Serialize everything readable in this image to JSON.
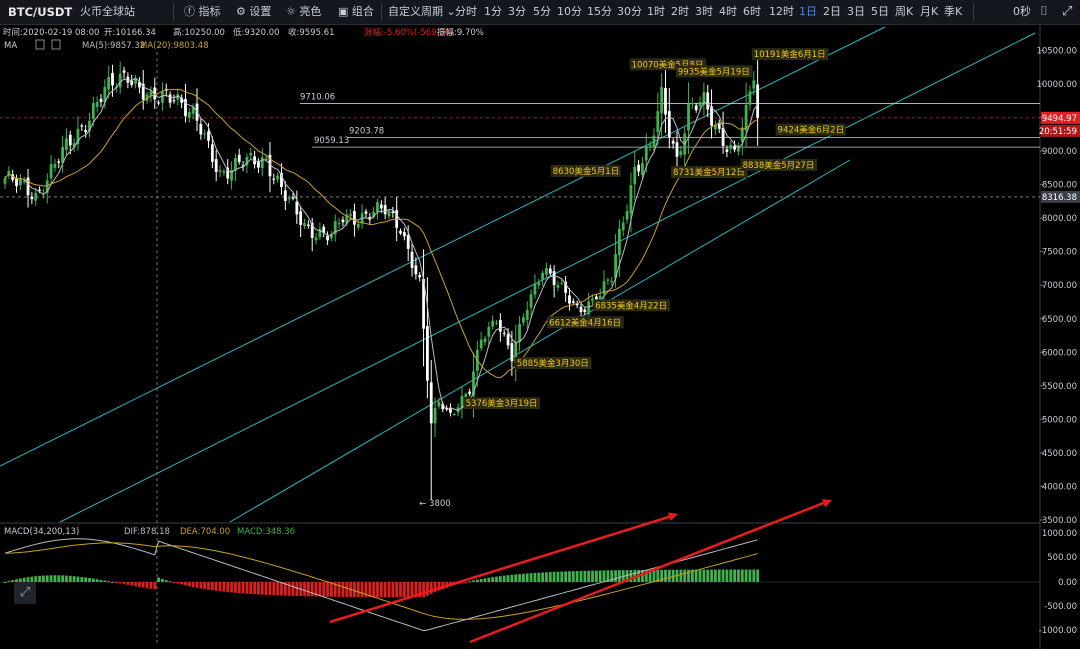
{
  "toolbar": {
    "symbol": "BTC/USDT",
    "exchange": "火币全球站",
    "indicator": "指标",
    "settings": "设置",
    "theme": "亮色",
    "combo": "组合",
    "custom": "自定义周期",
    "periods": [
      "分时",
      "1分",
      "3分",
      "5分",
      "10分",
      "15分",
      "30分",
      "1时",
      "2时",
      "3时",
      "4时",
      "6时",
      "12时",
      "1日",
      "2日",
      "3日",
      "5日",
      "周K",
      "月K",
      "季K"
    ],
    "active_period": "1日",
    "countdown": "0秒"
  },
  "info": {
    "time": "时间:2020-02-19 08:00",
    "open": "开:10166.34",
    "high": "高:10250.00",
    "low": "低:9320.00",
    "close": "收:9595.61",
    "change": "涨幅:-5.60%(-569.30)",
    "amp": "振幅:9.70%",
    "ma_label": "MA",
    "ma5": "MA(5):9857.32",
    "ma20": "MA(20):9803.48"
  },
  "macd_info": {
    "label": "MACD(34,200,13)",
    "dif": "DIF:878.18",
    "dea": "DEA:704.00",
    "macd": "MACD:348.36"
  },
  "colors": {
    "up": "#3fb34f",
    "down": "#ffffff",
    "ma5": "#b8bcc4",
    "ma20": "#c9a227",
    "channel": "#27b7bf",
    "arrow": "#e81c1c",
    "label_bg": "#2b2b14",
    "label_fg": "#f0c419",
    "price_tag": "#e02020"
  },
  "price_axis": {
    "ticks": [
      10500,
      10000,
      9500,
      9000,
      8500,
      8000,
      7500,
      7000,
      6500,
      6000,
      5500,
      5000,
      4500,
      4000,
      3500
    ],
    "current": "9494.97",
    "timer": "20:51:59",
    "hline": "8316.38"
  },
  "macd_axis": {
    "ticks": [
      "1000.00",
      "500.00",
      "0.00",
      "-500.00",
      "-1000.00"
    ]
  },
  "hlines": [
    {
      "price": 9710.06,
      "label": "9710.06"
    },
    {
      "price": 9203.78,
      "label": "9203.78"
    },
    {
      "price": 9059.13,
      "label": "9059.13"
    }
  ],
  "annotations": [
    {
      "text": "10191美金6月1日",
      "price": 10191,
      "idx": 195
    },
    {
      "text": "10070美金5月8日",
      "price": 10070,
      "idx": 171
    },
    {
      "text": "9935美金5月19日",
      "price": 9935,
      "idx": 182
    },
    {
      "text": "9424美金6月2日",
      "price": 9424,
      "idx": 196
    },
    {
      "text": "8630美金5月1日",
      "price": 8630,
      "idx": 164
    },
    {
      "text": "8731美金5月12日",
      "price": 8731,
      "idx": 175
    },
    {
      "text": "8838美金5月27日",
      "price": 8838,
      "idx": 190
    },
    {
      "text": "6835美金4月22日",
      "price": 6835,
      "idx": 155
    },
    {
      "text": "6612美金4月16日",
      "price": 6612,
      "idx": 149
    },
    {
      "text": "5885美金3月30日",
      "price": 5885,
      "idx": 132
    },
    {
      "text": "5376美金3月19日",
      "price": 5376,
      "idx": 121
    },
    {
      "text": "3800",
      "price": 3800,
      "idx": 111
    }
  ],
  "chart_data": {
    "type": "candlestick",
    "title": "BTC/USDT",
    "ylim": [
      3350,
      10750
    ],
    "anchors": [
      {
        "i": 0,
        "p": 8600
      },
      {
        "i": 8,
        "p": 8350
      },
      {
        "i": 15,
        "p": 8950
      },
      {
        "i": 25,
        "p": 9800
      },
      {
        "i": 32,
        "p": 10200
      },
      {
        "i": 38,
        "p": 9700
      },
      {
        "i": 44,
        "p": 9900
      },
      {
        "i": 50,
        "p": 9400
      },
      {
        "i": 56,
        "p": 8700
      },
      {
        "i": 62,
        "p": 8800
      },
      {
        "i": 68,
        "p": 8900
      },
      {
        "i": 73,
        "p": 8300
      },
      {
        "i": 78,
        "p": 7900
      },
      {
        "i": 85,
        "p": 7700
      },
      {
        "i": 88,
        "p": 8000
      },
      {
        "i": 99,
        "p": 8100
      },
      {
        "i": 103,
        "p": 7900
      },
      {
        "i": 108,
        "p": 7000
      },
      {
        "i": 111,
        "p": 4900
      },
      {
        "i": 113,
        "p": 5300
      },
      {
        "i": 116,
        "p": 5100
      },
      {
        "i": 121,
        "p": 5400
      },
      {
        "i": 124,
        "p": 6200
      },
      {
        "i": 128,
        "p": 6550
      },
      {
        "i": 132,
        "p": 5900
      },
      {
        "i": 136,
        "p": 6700
      },
      {
        "i": 140,
        "p": 7300
      },
      {
        "i": 145,
        "p": 6900
      },
      {
        "i": 149,
        "p": 6650
      },
      {
        "i": 155,
        "p": 6850
      },
      {
        "i": 158,
        "p": 7100
      },
      {
        "i": 160,
        "p": 7750
      },
      {
        "i": 164,
        "p": 8750
      },
      {
        "i": 168,
        "p": 9000
      },
      {
        "i": 171,
        "p": 9800
      },
      {
        "i": 175,
        "p": 8900
      },
      {
        "i": 178,
        "p": 9600
      },
      {
        "i": 182,
        "p": 9700
      },
      {
        "i": 186,
        "p": 9300
      },
      {
        "i": 190,
        "p": 8950
      },
      {
        "i": 193,
        "p": 9500
      },
      {
        "i": 195,
        "p": 10150
      },
      {
        "i": 196,
        "p": 9495
      }
    ]
  }
}
